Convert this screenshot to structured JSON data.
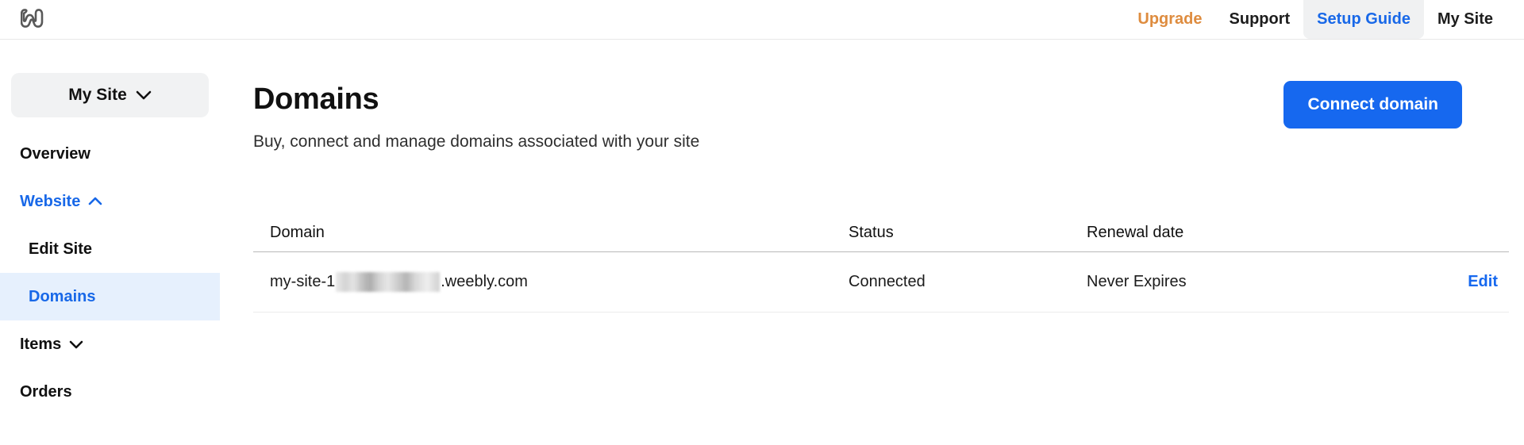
{
  "topbar": {
    "logo_icon": "weebly-w-logo-icon",
    "nav": [
      {
        "label": "Upgrade",
        "style": "upgrade"
      },
      {
        "label": "Support",
        "style": "plain"
      },
      {
        "label": "Setup Guide",
        "style": "setup"
      },
      {
        "label": "My Site",
        "style": "plain"
      }
    ]
  },
  "sidebar": {
    "site_switcher": {
      "label": "My Site",
      "icon": "chevron-down-icon"
    },
    "items": [
      {
        "label": "Overview",
        "state": "plain",
        "icon": ""
      },
      {
        "label": "Website",
        "state": "expanded",
        "icon": "chevron-up-icon"
      },
      {
        "label": "Edit Site",
        "state": "sub",
        "icon": ""
      },
      {
        "label": "Domains",
        "state": "active-sub",
        "icon": ""
      },
      {
        "label": "Items",
        "state": "collapsed",
        "icon": "chevron-down-icon"
      },
      {
        "label": "Orders",
        "state": "plain",
        "icon": ""
      }
    ]
  },
  "main": {
    "title": "Domains",
    "subtitle": "Buy, connect and manage domains associated with your site",
    "connect_button": "Connect domain",
    "table": {
      "headers": [
        "Domain",
        "Status",
        "Renewal date",
        ""
      ],
      "rows": [
        {
          "domain_prefix": "my-site-1",
          "domain_redacted": true,
          "domain_suffix": ".weebly.com",
          "status": "Connected",
          "renewal_date": "Never Expires",
          "action": "Edit"
        }
      ]
    }
  },
  "colors": {
    "accent_blue": "#1668ef",
    "link_blue": "#1868e8",
    "upgrade_orange": "#de8c3f",
    "active_bg": "#e6f0fd",
    "pill_gray": "#f1f2f3"
  }
}
